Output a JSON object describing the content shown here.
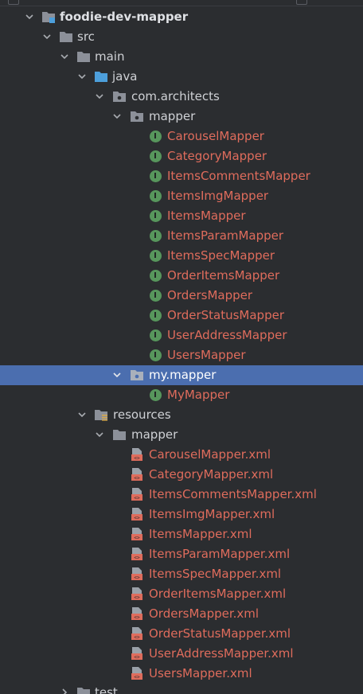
{
  "project": {
    "name": "foodie-dev-mapper"
  },
  "nodes": {
    "src": "src",
    "main": "main",
    "java": "java",
    "package": "com.architects",
    "mapper_pkg": "mapper",
    "my_mapper_pkg": "my.mapper",
    "my_mapper_iface": "MyMapper",
    "resources": "resources",
    "resources_mapper": "mapper",
    "test": "test"
  },
  "mapper_interfaces": [
    "CarouselMapper",
    "CategoryMapper",
    "ItemsCommentsMapper",
    "ItemsImgMapper",
    "ItemsMapper",
    "ItemsParamMapper",
    "ItemsSpecMapper",
    "OrderItemsMapper",
    "OrdersMapper",
    "OrderStatusMapper",
    "UserAddressMapper",
    "UsersMapper"
  ],
  "mapper_xml_files": [
    "CarouselMapper.xml",
    "CategoryMapper.xml",
    "ItemsCommentsMapper.xml",
    "ItemsImgMapper.xml",
    "ItemsMapper.xml",
    "ItemsParamMapper.xml",
    "ItemsSpecMapper.xml",
    "OrderItemsMapper.xml",
    "OrdersMapper.xml",
    "OrderStatusMapper.xml",
    "UserAddressMapper.xml",
    "UsersMapper.xml"
  ],
  "selected_node": "my.mapper",
  "colors": {
    "background": "#2b2d30",
    "selection": "#4b6eaf",
    "modified_file_text": "#df6c5c",
    "interface_badge": "#57965c",
    "folder": "#8c9099",
    "source_root": "#4d9fdb"
  }
}
